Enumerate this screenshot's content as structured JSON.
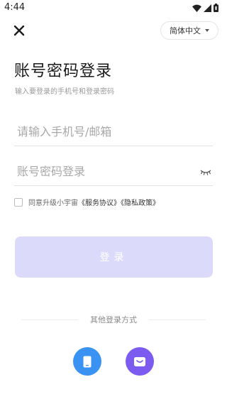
{
  "status_bar": {
    "time": "4:44"
  },
  "header": {
    "language_label": "简体中文"
  },
  "page": {
    "title": "账号密码登录",
    "subtitle": "输入要登录的手机号和登录密码"
  },
  "form": {
    "account_placeholder": "请输入手机号/邮箱",
    "password_placeholder": "账号密码登录",
    "agree_prefix": "同意升级小宇宙",
    "agree_service_link": "《服务协议》",
    "agree_privacy_link": "《隐私政策》",
    "login_label": "登录"
  },
  "other_login": {
    "label": "其他登录方式",
    "methods": [
      {
        "icon": "phone-icon",
        "color": "#3a93f2"
      },
      {
        "icon": "mail-icon",
        "color": "#7b5bf0"
      }
    ]
  },
  "colors": {
    "primary_disabled": "#dcdafb",
    "phone": "#3a93f2",
    "mail": "#7b5bf0"
  }
}
